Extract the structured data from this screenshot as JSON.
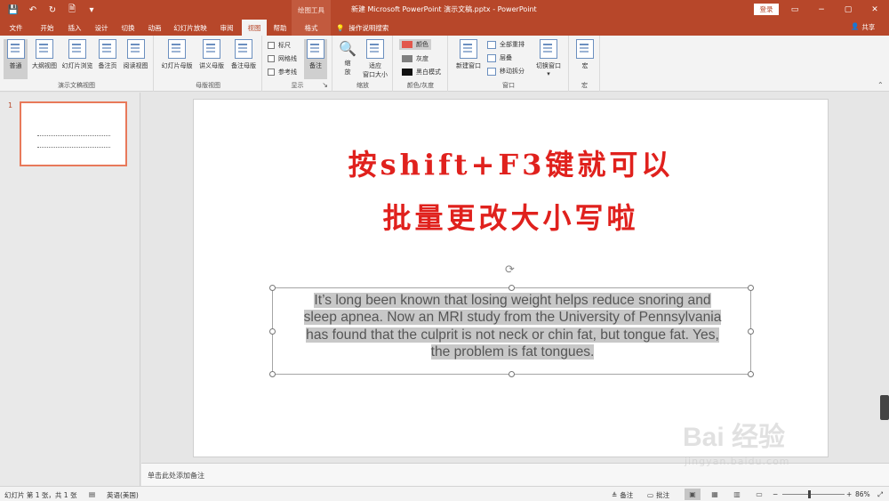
{
  "window": {
    "doc_title": "新建 Microsoft PowerPoint 演示文稿.pptx  -  PowerPoint",
    "context_tool": "绘图工具",
    "login_label": "登录",
    "share_label": "共享",
    "minimize": "−",
    "restore": "▢",
    "close": "✕",
    "ribbon_display": "▭"
  },
  "qat": [
    "💾",
    "↶",
    "↻",
    "🗎",
    "▾"
  ],
  "tabs": [
    "文件",
    "开始",
    "插入",
    "设计",
    "切换",
    "动画",
    "幻灯片放映",
    "审阅",
    "视图",
    "帮助",
    "格式"
  ],
  "active_tab": "视图",
  "tellme": "操作说明搜索",
  "ribbon": {
    "views": {
      "label": "演示文稿视图",
      "buttons": [
        "普通",
        "大纲视图",
        "幻灯片浏览",
        "备注页",
        "阅读视图"
      ]
    },
    "master": {
      "label": "母版视图",
      "buttons": [
        "幻灯片母版",
        "讲义母版",
        "备注母版"
      ]
    },
    "show": {
      "label": "显示",
      "checks": [
        "标尺",
        "网格线",
        "参考线"
      ],
      "notes_button": "备注"
    },
    "zoom": {
      "label": "缩放",
      "zoom_button_l1": "缩",
      "zoom_button_l2": "放",
      "fit_button_l1": "适应",
      "fit_button_l2": "窗口大小"
    },
    "color": {
      "label": "颜色/灰度",
      "items": [
        "颜色",
        "灰度",
        "黑白模式"
      ],
      "swatches": [
        "#e2574c",
        "#7f7f7f",
        "#111111"
      ]
    },
    "window": {
      "label": "窗口",
      "new_window": "新建窗口",
      "items": [
        "全部重排",
        "层叠",
        "移动拆分"
      ],
      "switch_window": "切换窗口"
    },
    "macros": {
      "label": "宏",
      "button": "宏"
    }
  },
  "slides_pane": {
    "slide_number": "1"
  },
  "slide": {
    "title_line1": "按shift+F3键就可以",
    "title_line2": "批量更改大小写啦",
    "body_lines": [
      "It’s long been known that losing weight helps reduce snoring and",
      "sleep apnea. Now an MRI study from the University of Pennsylvania",
      "has found that the culprit is not neck or chin fat, but tongue fat. Yes,",
      "the problem is fat tongues."
    ],
    "title_color": "#e0211d"
  },
  "notes_placeholder": "单击此处添加备注",
  "status": {
    "slide_info": "幻灯片 第 1 张，共 1 张",
    "language": "英语(美国)",
    "notes": "备注",
    "comments": "批注",
    "zoom_minus": "−",
    "zoom_plus": "+",
    "zoom_percent": "86%",
    "zoom_level": 0.86
  },
  "watermark": {
    "brand": "Bai 经验",
    "url": "jingyan.baidu.com"
  }
}
